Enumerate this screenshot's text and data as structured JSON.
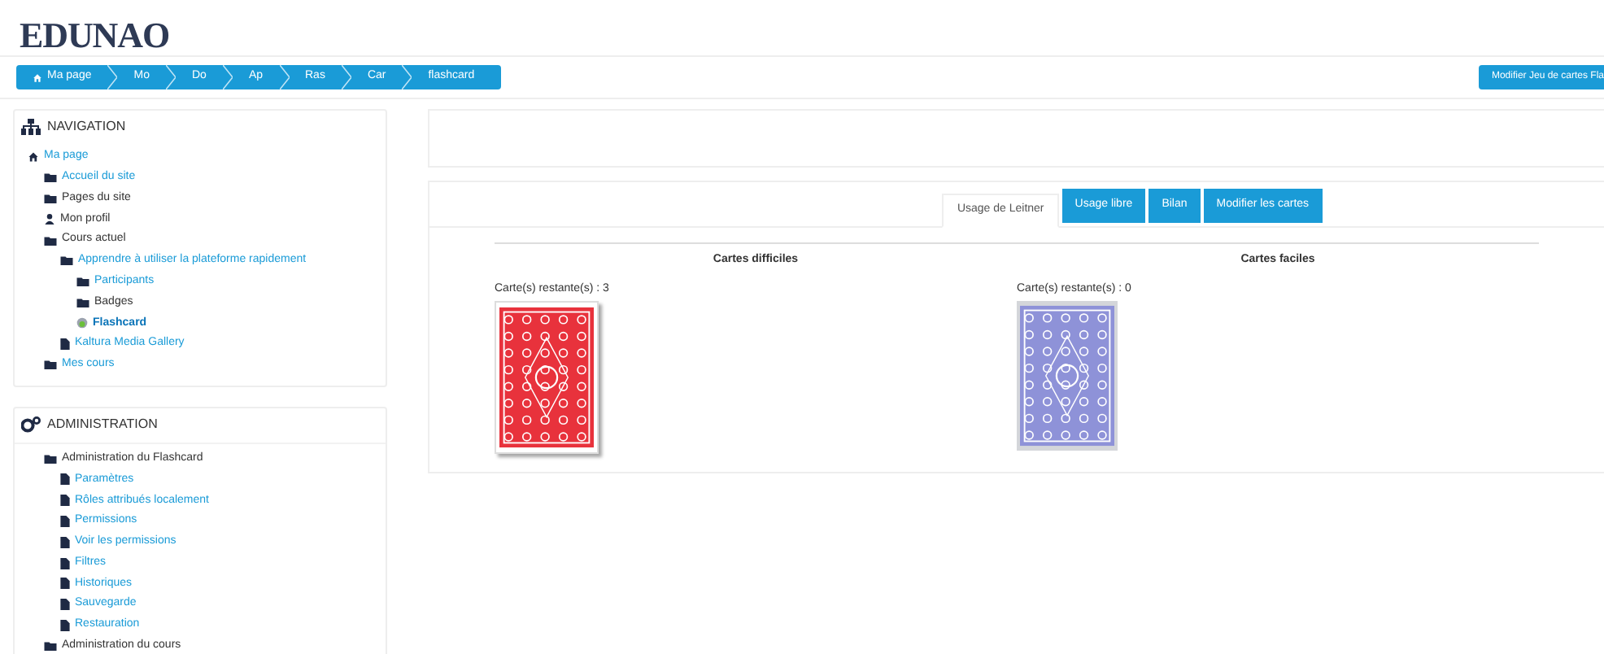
{
  "logo": {
    "text": "EDUNAO"
  },
  "breadcrumb": [
    {
      "label": "Ma page"
    },
    {
      "label": "Mo"
    },
    {
      "label": "Do"
    },
    {
      "label": "Ap"
    },
    {
      "label": "Ras"
    },
    {
      "label": "Car"
    },
    {
      "label": "flashcard"
    }
  ],
  "header_button": {
    "label": "Modifier Jeu de cartes Fla"
  },
  "navigation": {
    "title": "NAVIGATION",
    "items": [
      {
        "label": "Ma page",
        "kind": "home",
        "link": true,
        "current": false,
        "children": [
          {
            "label": "Accueil du site",
            "kind": "folder",
            "link": true,
            "current": false
          },
          {
            "label": "Pages du site",
            "kind": "folder",
            "link": false,
            "current": false
          },
          {
            "label": "Mon profil",
            "kind": "user",
            "link": false,
            "current": false
          },
          {
            "label": "Cours actuel",
            "kind": "folder",
            "link": false,
            "current": false,
            "children": [
              {
                "label": "Apprendre à utiliser la plateforme rapidement",
                "kind": "folder",
                "link": true,
                "current": false,
                "children": [
                  {
                    "label": "Participants",
                    "kind": "folder",
                    "link": true,
                    "current": false
                  },
                  {
                    "label": "Badges",
                    "kind": "folder",
                    "link": false,
                    "current": false
                  },
                  {
                    "label": "Flashcard",
                    "kind": "activity",
                    "link": true,
                    "current": true
                  }
                ]
              },
              {
                "label": "Kaltura Media Gallery",
                "kind": "document",
                "link": true,
                "current": false
              }
            ]
          },
          {
            "label": "Mes cours",
            "kind": "folder",
            "link": true,
            "current": false
          }
        ]
      }
    ]
  },
  "administration": {
    "title": "ADMINISTRATION",
    "items": [
      {
        "label": "Administration du Flashcard",
        "kind": "folder",
        "link": false,
        "current": false,
        "children": [
          {
            "label": "Paramètres",
            "kind": "document",
            "link": true,
            "current": false
          },
          {
            "label": "Rôles attribués localement",
            "kind": "document",
            "link": true,
            "current": false
          },
          {
            "label": "Permissions",
            "kind": "document",
            "link": true,
            "current": false
          },
          {
            "label": "Voir les permissions",
            "kind": "document",
            "link": true,
            "current": false
          },
          {
            "label": "Filtres",
            "kind": "document",
            "link": true,
            "current": false
          },
          {
            "label": "Historiques",
            "kind": "document",
            "link": true,
            "current": false
          },
          {
            "label": "Sauvegarde",
            "kind": "document",
            "link": true,
            "current": false
          },
          {
            "label": "Restauration",
            "kind": "document",
            "link": true,
            "current": false
          }
        ]
      },
      {
        "label": "Administration du cours",
        "kind": "folder",
        "link": false,
        "current": false
      }
    ]
  },
  "tabs": [
    {
      "label": "Usage de Leitner",
      "selected": true
    },
    {
      "label": "Usage libre",
      "selected": false
    },
    {
      "label": "Bilan",
      "selected": false
    },
    {
      "label": "Modifier les cartes",
      "selected": false
    }
  ],
  "decks": [
    {
      "title": "Cartes difficiles",
      "remaining": "Carte(s) restante(s) : 3",
      "color": "#e8323c",
      "disabled": false
    },
    {
      "title": "Cartes faciles",
      "remaining": "Carte(s) restante(s) : 0",
      "color": "#8e92d8",
      "disabled": true
    }
  ]
}
